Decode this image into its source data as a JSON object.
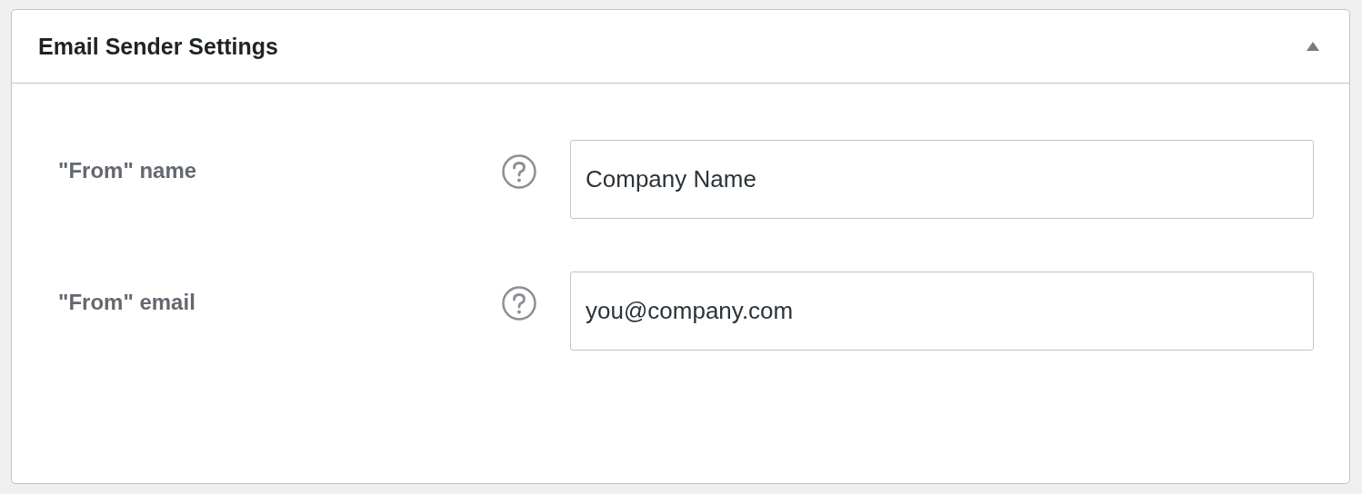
{
  "panel": {
    "title": "Email Sender Settings",
    "expanded": true
  },
  "fields": [
    {
      "label": "\"From\" name",
      "value": "Company Name"
    },
    {
      "label": "\"From\" email",
      "value": "you@company.com"
    }
  ]
}
